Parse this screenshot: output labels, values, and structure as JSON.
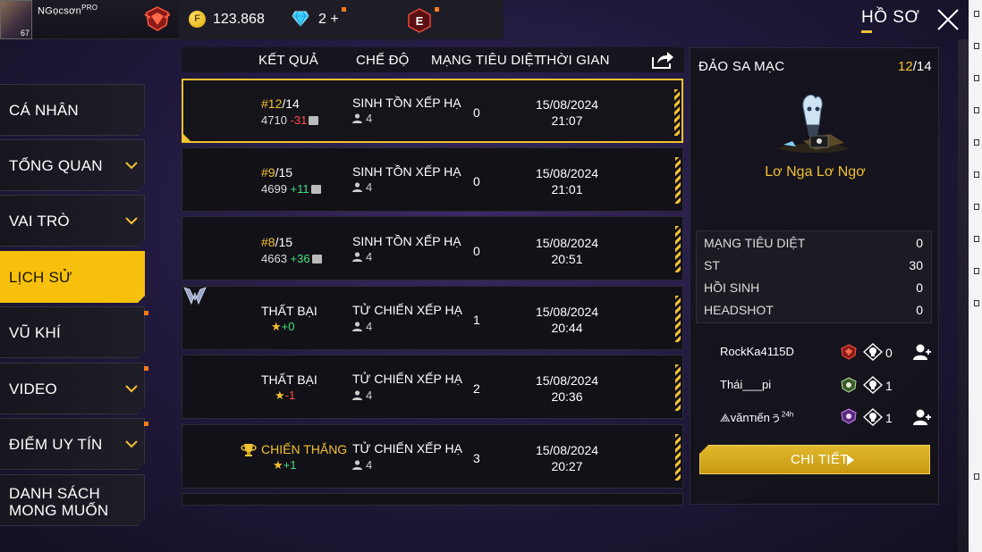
{
  "player": {
    "name": "NGọcsơn",
    "name_suffix": "PRO",
    "level": "67"
  },
  "currency": {
    "coins": "123.868",
    "coin_symbol": "F",
    "diamonds": "2",
    "diamonds_plus": "+"
  },
  "header": {
    "title": "HỒ SƠ"
  },
  "sidebar": {
    "items": [
      {
        "label": "CÁ NHÂN"
      },
      {
        "label": "TỔNG QUAN"
      },
      {
        "label": "VAI TRÒ"
      },
      {
        "label": "LỊCH SỬ"
      },
      {
        "label": "VŨ KHÍ"
      },
      {
        "label": "VIDEO"
      },
      {
        "label": "ĐIỂM UY TÍN"
      },
      {
        "label_line1": "DANH SÁCH",
        "label_line2": "MONG MUỐN"
      }
    ]
  },
  "table": {
    "headers": {
      "result": "KẾT QUẢ",
      "mode": "CHẾ ĐỘ",
      "kills": "MẠNG TIÊU DIỆT",
      "time": "THỜI GIAN"
    },
    "rows": [
      {
        "rank": "#12",
        "total": "/14",
        "points": "4710",
        "delta": "-31",
        "mode": "SINH TỒN XẾP HẠ",
        "party": "4",
        "kills": "0",
        "date": "15/08/2024",
        "time": "21:07"
      },
      {
        "rank": "#9",
        "total": "/15",
        "points": "4699",
        "delta": "+11",
        "mode": "SINH TỒN XẾP HẠ",
        "party": "4",
        "kills": "0",
        "date": "15/08/2024",
        "time": "21:01"
      },
      {
        "rank": "#8",
        "total": "/15",
        "points": "4663",
        "delta": "+36",
        "mode": "SINH TỒN XẾP HẠ",
        "party": "4",
        "kills": "0",
        "date": "15/08/2024",
        "time": "20:51"
      },
      {
        "result": "THẤT BẠI",
        "star_delta": "+0",
        "mode": "TỬ CHIẾN XẾP HẠ",
        "party": "4",
        "kills": "1",
        "date": "15/08/2024",
        "time": "20:44"
      },
      {
        "result": "THẤT BẠI",
        "star_delta": "-1",
        "mode": "TỬ CHIẾN XẾP HẠ",
        "party": "4",
        "kills": "2",
        "date": "15/08/2024",
        "time": "20:36"
      },
      {
        "result": "CHIẾN THẮNG",
        "star_delta": "+1",
        "mode": "TỬ CHIẾN XẾP HẠ",
        "party": "4",
        "kills": "3",
        "date": "15/08/2024",
        "time": "20:27"
      }
    ]
  },
  "detail": {
    "map": "ĐẢO SA MẠC",
    "rank": "12",
    "rank_total": "/14",
    "character": "Lơ Nga Lơ Ngơ",
    "stats": [
      {
        "label": "MẠNG TIÊU DIỆT",
        "value": "0"
      },
      {
        "label": "ST",
        "value": "30"
      },
      {
        "label": "HỒI SINH",
        "value": "0"
      },
      {
        "label": "HEADSHOT",
        "value": "0"
      }
    ],
    "team": [
      {
        "name": "RockKa4115D",
        "kills": "0"
      },
      {
        "name": "Thái___pi",
        "kills": "1"
      },
      {
        "name": "vănтιếnぅ",
        "name_suffix": "24h",
        "kills": "1"
      }
    ],
    "button_label": "CHI TIẾT"
  },
  "colors": {
    "accent": "#f2c230",
    "active_tab": "#f7c00d",
    "negative": "#ff4b4b",
    "positive": "#44e07a"
  }
}
